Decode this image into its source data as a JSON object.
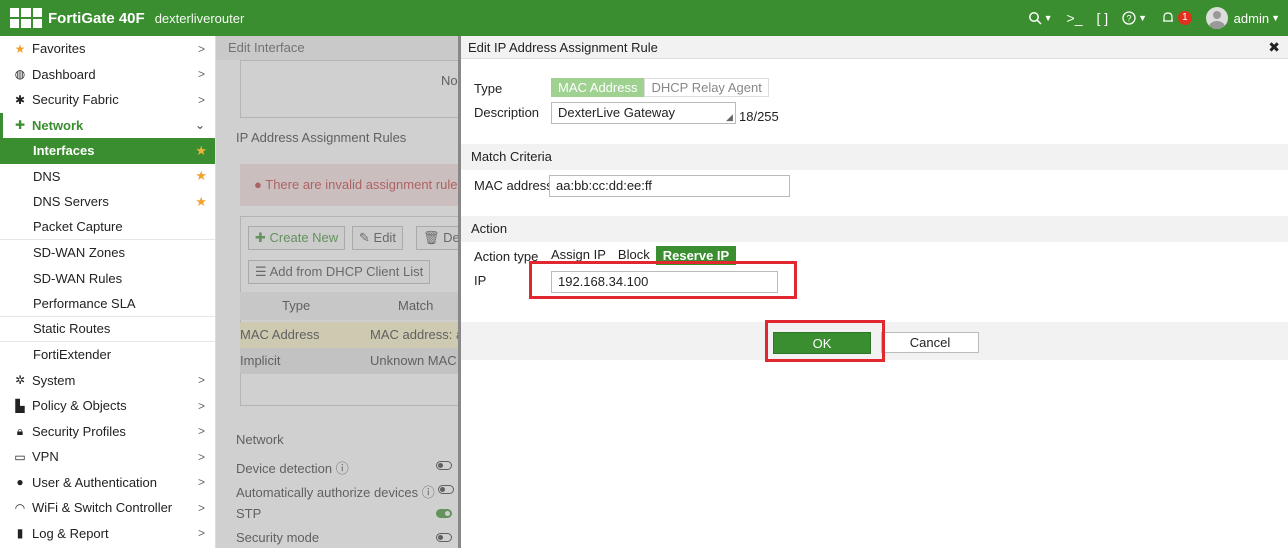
{
  "topbar": {
    "product": "FortiGate 40F",
    "hostname": "dexterliverouter",
    "search_icon": "search-icon",
    "cli_icon": "terminal-icon",
    "fullscreen_icon": "fullscreen-icon",
    "help_icon": "help-icon",
    "alert_count": "1",
    "user": "admin",
    "accent_color": "#3a8e2f"
  },
  "sidebar": {
    "items": [
      {
        "label": "Favorites",
        "icon": "star-icon"
      },
      {
        "label": "Dashboard",
        "icon": "dashboard-icon"
      },
      {
        "label": "Security Fabric",
        "icon": "fabric-icon"
      },
      {
        "label": "Network",
        "icon": "network-icon"
      }
    ],
    "network_sub": [
      {
        "label": "Interfaces"
      },
      {
        "label": "DNS"
      },
      {
        "label": "DNS Servers"
      },
      {
        "label": "Packet Capture"
      },
      {
        "label": "SD-WAN Zones"
      },
      {
        "label": "SD-WAN Rules"
      },
      {
        "label": "Performance SLA"
      },
      {
        "label": "Static Routes"
      },
      {
        "label": "FortiExtender"
      }
    ],
    "items_after": [
      {
        "label": "System",
        "icon": "gear-icon"
      },
      {
        "label": "Policy & Objects",
        "icon": "policy-icon"
      },
      {
        "label": "Security Profiles",
        "icon": "lock-icon"
      },
      {
        "label": "VPN",
        "icon": "laptop-icon"
      },
      {
        "label": "User & Authentication",
        "icon": "user-icon"
      },
      {
        "label": "WiFi & Switch Controller",
        "icon": "wifi-icon"
      },
      {
        "label": "Log & Report",
        "icon": "chart-icon"
      }
    ]
  },
  "background_panel": {
    "title": "Edit Interface",
    "truncated_text": "No",
    "section_title": "IP Address Assignment Rules",
    "alert": "There are invalid assignment rule",
    "create_new": "Create New",
    "edit": "Edit",
    "delete": "De",
    "add_from_dhcp": "Add from DHCP Client List",
    "table_head": {
      "type": "Type",
      "match": "Match"
    },
    "rows": [
      {
        "type": "MAC Address",
        "match": "MAC address: aa"
      },
      {
        "type": "Implicit",
        "match": "Unknown MAC A"
      }
    ],
    "network_section": "Network",
    "network_rows": [
      {
        "label": "Device detection"
      },
      {
        "label": "Automatically authorize devices"
      },
      {
        "label": "STP"
      },
      {
        "label": "Security mode"
      }
    ]
  },
  "dialog": {
    "title": "Edit IP Address Assignment Rule",
    "type_label": "Type",
    "type_options": [
      "MAC Address",
      "DHCP Relay Agent"
    ],
    "description_label": "Description",
    "description_value": "DexterLive Gateway",
    "description_counter": "18/255",
    "match_section": "Match Criteria",
    "mac_label": "MAC address",
    "mac_value": "aa:bb:cc:dd:ee:ff",
    "action_section": "Action",
    "action_type_label": "Action type",
    "action_options": [
      "Assign IP",
      "Block",
      "Reserve IP"
    ],
    "ip_label": "IP",
    "ip_value": "192.168.34.100",
    "ok_label": "OK",
    "cancel_label": "Cancel"
  }
}
